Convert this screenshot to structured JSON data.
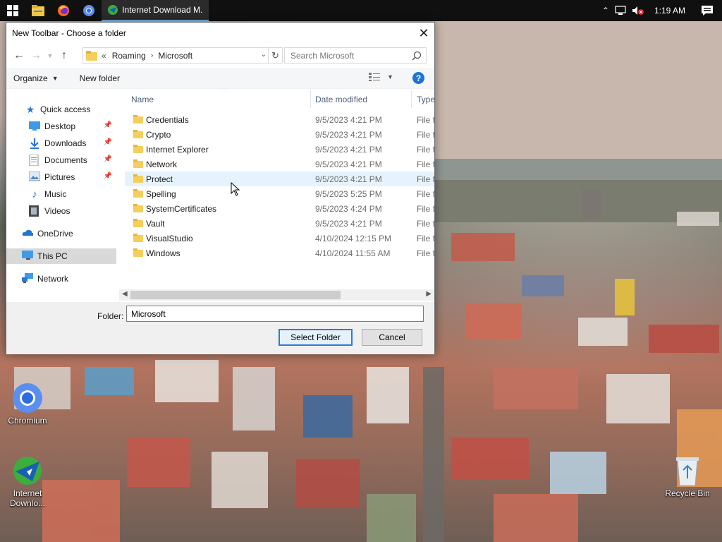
{
  "taskbar": {
    "app_label": "Internet Download M...",
    "time": "1:19 AM"
  },
  "dialog": {
    "title": "New Toolbar - Choose a folder",
    "breadcrumb": {
      "overflow": "«",
      "parts": [
        "Roaming",
        "Microsoft"
      ]
    },
    "search_placeholder": "Search Microsoft",
    "commands": {
      "organize": "Organize",
      "new_folder": "New folder"
    },
    "nav": {
      "quick_access": "Quick access",
      "desktop": "Desktop",
      "downloads": "Downloads",
      "documents": "Documents",
      "pictures": "Pictures",
      "music": "Music",
      "videos": "Videos",
      "onedrive": "OneDrive",
      "this_pc": "This PC",
      "network": "Network"
    },
    "columns": {
      "name": "Name",
      "date": "Date modified",
      "type": "Type"
    },
    "files": [
      {
        "name": "Credentials",
        "date": "9/5/2023 4:21 PM",
        "type": "File fo"
      },
      {
        "name": "Crypto",
        "date": "9/5/2023 4:21 PM",
        "type": "File fo"
      },
      {
        "name": "Internet Explorer",
        "date": "9/5/2023 4:21 PM",
        "type": "File fo"
      },
      {
        "name": "Network",
        "date": "9/5/2023 4:21 PM",
        "type": "File fo"
      },
      {
        "name": "Protect",
        "date": "9/5/2023 4:21 PM",
        "type": "File fo"
      },
      {
        "name": "Spelling",
        "date": "9/5/2023 5:25 PM",
        "type": "File fo"
      },
      {
        "name": "SystemCertificates",
        "date": "9/5/2023 4:24 PM",
        "type": "File fo"
      },
      {
        "name": "Vault",
        "date": "9/5/2023 4:21 PM",
        "type": "File fo"
      },
      {
        "name": "VisualStudio",
        "date": "4/10/2024 12:15 PM",
        "type": "File fo"
      },
      {
        "name": "Windows",
        "date": "4/10/2024 11:55 AM",
        "type": "File fo"
      }
    ],
    "folder_label": "Folder:",
    "folder_value": "Microsoft",
    "select_button": "Select Folder",
    "cancel_button": "Cancel"
  },
  "desktop_icons": {
    "chromium": "Chromium",
    "idm": "Internet Downlo...",
    "recycle_bin": "Recycle Bin"
  },
  "colors": {
    "accent": "#1e73d8",
    "folder": "#f4cf5b",
    "hover_row": "#e5f3ff",
    "selected_nav": "#d9d9d9"
  }
}
